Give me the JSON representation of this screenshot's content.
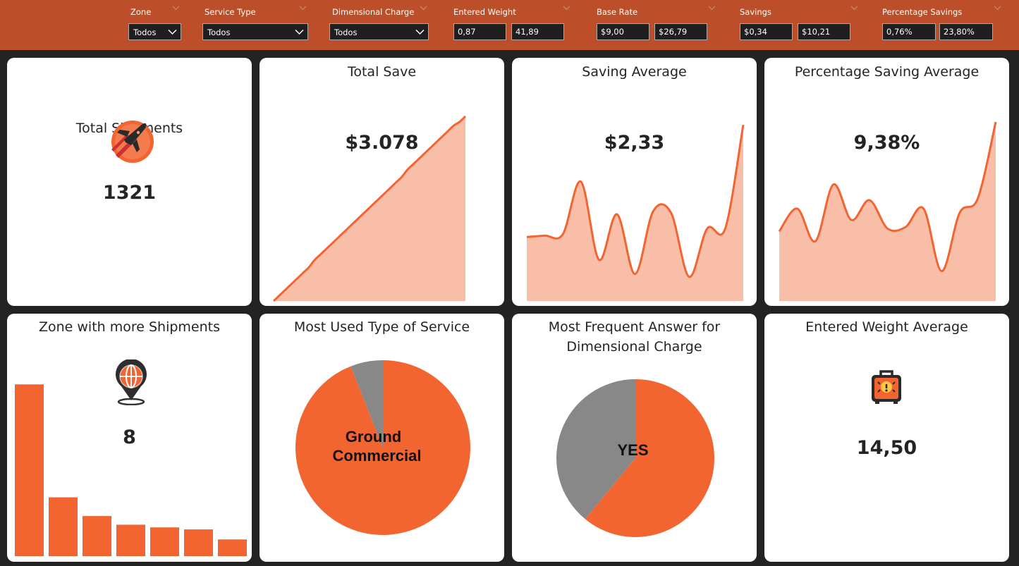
{
  "filters": {
    "zone": {
      "label": "Zone",
      "value": "Todos"
    },
    "service_type": {
      "label": "Service Type",
      "value": "Todos"
    },
    "dimensional_charge": {
      "label": "Dimensional Charge",
      "value": "Todos"
    },
    "entered_weight": {
      "label": "Entered Weight",
      "min": "0,87",
      "max": "41,89"
    },
    "base_rate": {
      "label": "Base Rate",
      "min": "$9,00",
      "max": "$26,79"
    },
    "savings": {
      "label": "Savings",
      "min": "$0,34",
      "max": "$10,21"
    },
    "percentage_savings": {
      "label": "Percentage Savings",
      "min": "0,76%",
      "max": "23,80%"
    }
  },
  "cards": {
    "total_shipments": {
      "title": "Total Shipments",
      "value": "1321",
      "icon": "airplane-icon"
    },
    "total_save": {
      "title": "Total Save",
      "value": "$3.078"
    },
    "saving_average": {
      "title": "Saving Average",
      "value": "$2,33"
    },
    "percentage_saving_average": {
      "title": "Percentage Saving Average",
      "value": "9,38%"
    },
    "zone_more_shipments": {
      "title": "Zone with more Shipments",
      "value": "8",
      "icon": "map-pin-globe-icon"
    },
    "most_used_service": {
      "title": "Most Used Type of Service",
      "label_line1": "Ground",
      "label_line2": "Commercial"
    },
    "dimensional_charge_answer": {
      "title_line1": "Most Frequent Answer for",
      "title_line2": "Dimensional Charge",
      "label": "YES"
    },
    "entered_weight_average": {
      "title": "Entered Weight Average",
      "value": "14,50",
      "icon": "luggage-scale-icon"
    }
  },
  "colors": {
    "accent": "#f26430",
    "area_fill": "#f9bea7",
    "secondary": "#888888",
    "topbar": "#bc4f2a",
    "background": "#232323"
  },
  "chart_data": [
    {
      "type": "area",
      "name": "total-save-trend",
      "values": [
        0,
        3,
        6,
        9,
        12,
        15,
        18,
        22,
        25,
        28,
        31,
        34,
        37,
        40,
        43,
        46,
        49,
        52,
        55,
        58,
        61,
        64,
        67,
        71,
        74,
        77,
        80,
        83,
        86,
        89,
        92,
        95,
        97,
        100
      ],
      "ylim": [
        0,
        100
      ]
    },
    {
      "type": "area",
      "name": "saving-average-trend",
      "values": [
        45,
        46,
        47,
        84,
        29,
        61,
        19,
        63,
        62,
        17,
        51,
        51,
        124
      ],
      "ylim": [
        0,
        130
      ]
    },
    {
      "type": "area",
      "name": "percentage-saving-average-trend",
      "values": [
        49,
        65,
        42,
        82,
        57,
        71,
        51,
        52,
        65,
        21,
        62,
        72,
        126
      ],
      "ylim": [
        0,
        130
      ]
    },
    {
      "type": "bar",
      "name": "zone-shipments",
      "values": [
        257,
        88,
        60,
        47,
        43,
        40,
        25
      ],
      "ylim": [
        0,
        270
      ]
    },
    {
      "type": "pie",
      "name": "service-type-share",
      "values": [
        94,
        6
      ],
      "slice_colors": [
        "#f26430",
        "#888888"
      ]
    },
    {
      "type": "pie",
      "name": "dimensional-charge-share",
      "values": [
        61,
        39
      ],
      "slice_colors": [
        "#f26430",
        "#888888"
      ]
    }
  ]
}
